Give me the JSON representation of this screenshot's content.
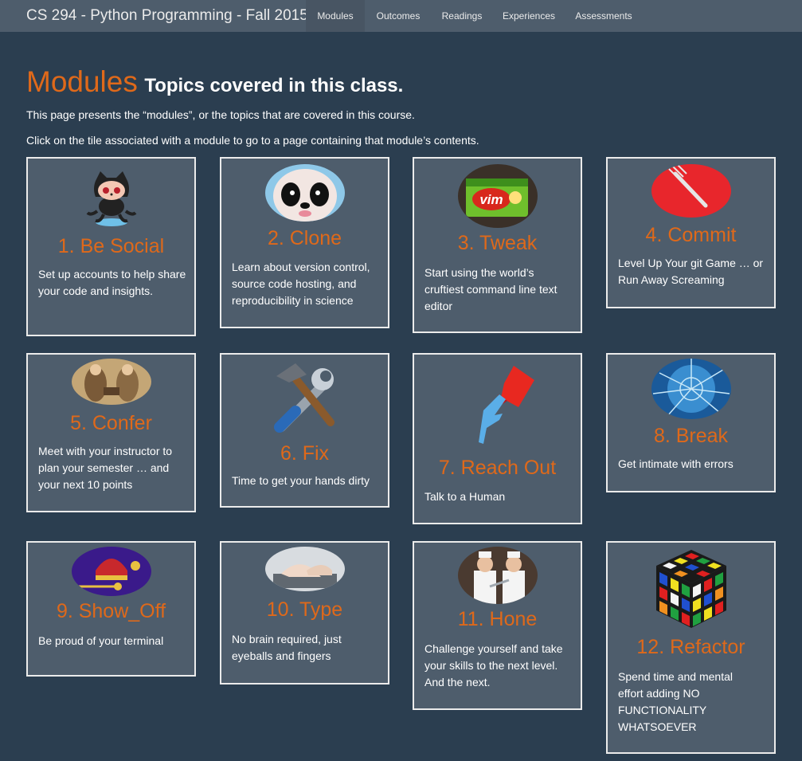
{
  "header": {
    "brand": "CS 294 - Python Programming - Fall 2015",
    "nav": [
      "Modules",
      "Outcomes",
      "Readings",
      "Experiences",
      "Assessments"
    ],
    "active": "Modules"
  },
  "page": {
    "title": "Modules",
    "subtitle": "Topics covered in this class.",
    "intro1": "This page presents the “modules”, or the topics that are covered in this course.",
    "intro2": "Click on the tile associated with a module to go to a page containing that module’s contents."
  },
  "modules": [
    {
      "title": "1. Be Social",
      "desc": "Set up accounts to help share your code and insights.",
      "icon": "octocat-icon"
    },
    {
      "title": "2. Clone",
      "desc": "Learn about version control, source code hosting, and reproducibility in science",
      "icon": "panda-icon"
    },
    {
      "title": "3. Tweak",
      "desc": "Start using the world’s cruftiest command line text editor",
      "icon": "vim-sponge-icon"
    },
    {
      "title": "4. Commit",
      "desc": "Level Up Your git Game … or Run Away Screaming",
      "icon": "fork-icon"
    },
    {
      "title": "5. Confer",
      "desc": "Meet with your instructor to plan your semester … and your next 10 points",
      "icon": "conference-painting-icon"
    },
    {
      "title": "6. Fix",
      "desc": "Time to get your hands dirty",
      "icon": "tools-icon"
    },
    {
      "title": "7. Reach Out",
      "desc": "Talk to a Human",
      "icon": "hands-touching-icon"
    },
    {
      "title": "8. Break",
      "desc": "Get intimate with errors",
      "icon": "broken-glass-icon"
    },
    {
      "title": "9. Show_Off",
      "desc": "Be proud of your terminal",
      "icon": "crown-jewels-icon"
    },
    {
      "title": "10. Type",
      "desc": "No brain required, just eyeballs and fingers",
      "icon": "typing-hands-icon"
    },
    {
      "title": "11. Hone",
      "desc": "Challenge yourself and take your skills to the next level. And the next.",
      "icon": "chefs-icon"
    },
    {
      "title": "12. Refactor",
      "desc": "Spend time and mental effort adding NO FUNCTIONALITY WHATSOEVER",
      "icon": "rubiks-cube-icon"
    }
  ],
  "colors": {
    "background": "#2b3e50",
    "navbar": "#4e5d6c",
    "tile": "#4e5d6c",
    "accent": "#df691a",
    "border": "#ebebeb"
  }
}
